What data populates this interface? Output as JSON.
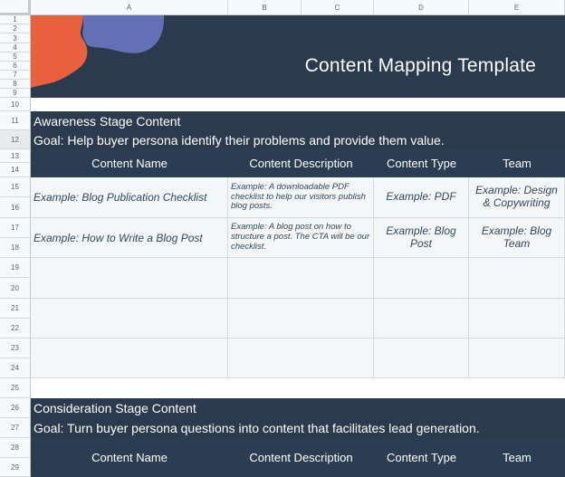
{
  "spreadsheet": {
    "column_headers": [
      "A",
      "B",
      "C",
      "D",
      "E"
    ],
    "row_numbers": [
      "1",
      "2",
      "3",
      "4",
      "5",
      "6",
      "7",
      "8",
      "9",
      "10",
      "11",
      "12",
      "13",
      "14",
      "15",
      "16",
      "17",
      "18",
      "19",
      "20",
      "21",
      "22",
      "23",
      "24",
      "25",
      "26",
      "27",
      "28",
      "29"
    ],
    "selected_row": "12"
  },
  "banner": {
    "title": "Content Mapping Template",
    "colors": {
      "background": "#2b3a4d",
      "orange_blob": "#e8613c",
      "purple_blob": "#6470b5"
    }
  },
  "awareness": {
    "title": "Awareness Stage Content",
    "goal": "Goal: Help buyer persona identify their problems and provide them value.",
    "columns": [
      "Content Name",
      "Content Description",
      "Content Type",
      "Team"
    ],
    "rows": [
      {
        "name": "Example: Blog Publication Checklist",
        "description": "Example: A downloadable PDF checklist to help our visitors publish blog posts.",
        "type": "Example: PDF",
        "team": "Example: Design & Copywriting"
      },
      {
        "name": "Example: How to Write a Blog Post",
        "description": "Example: A blog post on how to structure a post. The CTA will be our checklist.",
        "type": "Example: Blog Post",
        "team": "Example: Blog Team"
      },
      {
        "name": "",
        "description": "",
        "type": "",
        "team": ""
      },
      {
        "name": "",
        "description": "",
        "type": "",
        "team": ""
      },
      {
        "name": "",
        "description": "",
        "type": "",
        "team": ""
      }
    ]
  },
  "consideration": {
    "title": "Consideration Stage Content",
    "goal": "Goal: Turn buyer persona questions into content that facilitates lead generation.",
    "columns": [
      "Content Name",
      "Content Description",
      "Content Type",
      "Team"
    ]
  }
}
